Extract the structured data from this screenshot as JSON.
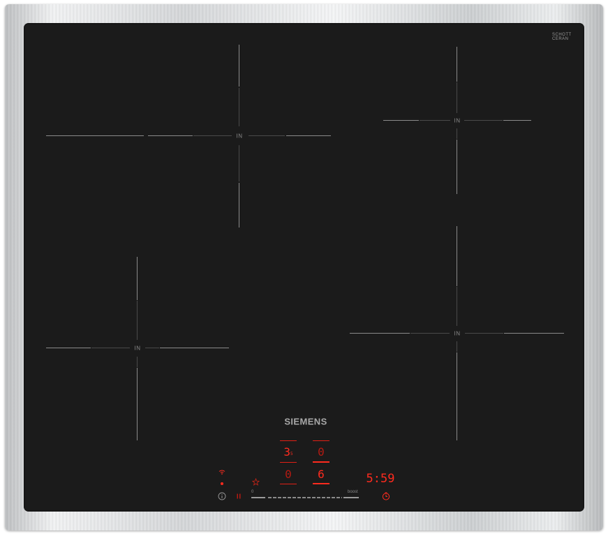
{
  "brand": "SIEMENS",
  "glass_maker": {
    "line1": "SCHOTT",
    "line2": "CERAN"
  },
  "glass_code": "",
  "top_code": "",
  "zones": [
    {
      "label": "IN"
    },
    {
      "label": "IN"
    },
    {
      "label": "IN"
    },
    {
      "label": "IN"
    }
  ],
  "controls": {
    "zone_front_left": "0",
    "zone_rear_left": "3",
    "zone_rear_left_suffix": "5",
    "zone_rear_right": "0",
    "zone_front_right": "6",
    "timer": "5:59",
    "slider_min": "0",
    "slider_max": "boost"
  },
  "colors": {
    "glass": "#1b1b1b",
    "indicator": "#ff2b1e",
    "frame": "#d9dbdd"
  },
  "icons": [
    "wifi-icon",
    "info-icon",
    "pause-icon",
    "favourite-star-icon",
    "timer-clock-icon"
  ]
}
